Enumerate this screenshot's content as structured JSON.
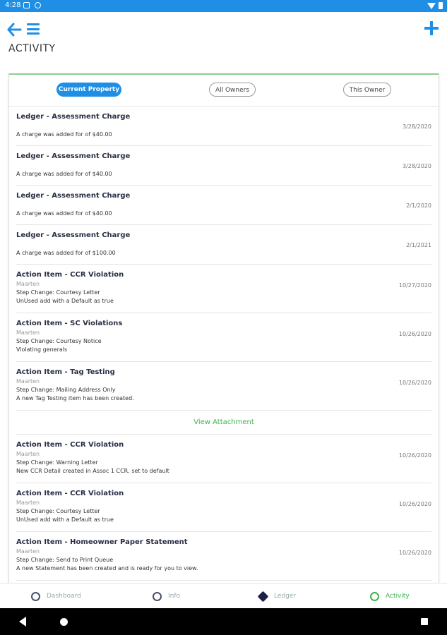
{
  "status_bar": {
    "time": "4:28"
  },
  "header": {
    "title": "ACTIVITY"
  },
  "filters": [
    "Current Property",
    "All Owners",
    "This Owner"
  ],
  "activities": [
    {
      "title": "Ledger - Assessment Charge",
      "sub": "",
      "lines": [
        "A charge was added for  of $40.00"
      ],
      "date": "3/28/2020"
    },
    {
      "title": "Ledger - Assessment Charge",
      "sub": "",
      "lines": [
        "A charge was added for  of $40.00"
      ],
      "date": "3/28/2020"
    },
    {
      "title": "Ledger - Assessment Charge",
      "sub": "",
      "lines": [
        "A charge was added for  of $40.00"
      ],
      "date": "2/1/2020"
    },
    {
      "title": "Ledger - Assessment Charge",
      "sub": "",
      "lines": [
        "A charge was added for  of $100.00"
      ],
      "date": "2/1/2021"
    },
    {
      "title": "Action Item - CCR Violation",
      "sub": "Maarten",
      "lines": [
        "Step Change: Courtesy Letter",
        "UnUsed add with a Default as true"
      ],
      "date": "10/27/2020"
    },
    {
      "title": "Action Item - SC Violations",
      "sub": "Maarten",
      "lines": [
        "Step Change: Courtesy Notice",
        "Violating generals"
      ],
      "date": "10/26/2020"
    },
    {
      "title": "Action Item - Tag Testing",
      "sub": "Maarten",
      "lines": [
        "Step Change: Mailing Address Only",
        "A new Tag Testing item has been created."
      ],
      "date": "10/26/2020"
    },
    {
      "title": "Action Item - CCR Violation",
      "sub": "Maarten",
      "lines": [
        "Step Change: Warning Letter",
        "New CCR Detail created in Assoc 1 CCR, set to default"
      ],
      "date": "10/26/2020"
    },
    {
      "title": "Action Item - CCR Violation",
      "sub": "Maarten",
      "lines": [
        "Step Change: Courtesy Letter",
        "UnUsed add with a Default as true"
      ],
      "date": "10/26/2020"
    },
    {
      "title": "Action Item - Homeowner Paper Statement",
      "sub": "Maarten",
      "lines": [
        "Step Change: Send to Print Queue",
        "A new Statement has been created and is ready for you to view."
      ],
      "date": "10/26/2020"
    }
  ],
  "attachment_label": "View Attachment",
  "bottom_nav": [
    "Dashboard",
    "Info",
    "Ledger",
    "Activity"
  ],
  "colors": {
    "primary": "#1f8fe6",
    "accent_green": "#3cb54a"
  }
}
